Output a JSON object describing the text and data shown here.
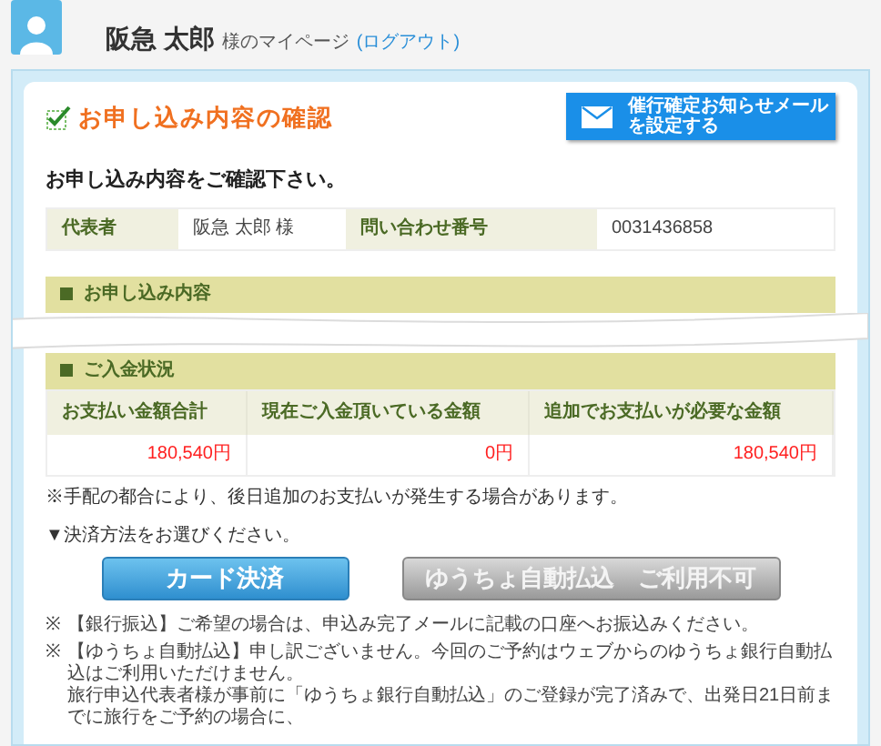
{
  "header": {
    "name": "阪急 太郎",
    "suffix": "様のマイページ",
    "logout": "(ログアウト)"
  },
  "title": "お申し込み内容の確認",
  "mail_button": {
    "lines": [
      "催行確定お知らせメール",
      "を設定する"
    ]
  },
  "prompt": "お申し込み内容をご確認下さい。",
  "info_table": [
    {
      "label": "代表者",
      "value": "阪急 太郎 様"
    },
    {
      "label": "問い合わせ番号",
      "value": "0031436858"
    }
  ],
  "application_section": {
    "heading": "お申し込み内容"
  },
  "payment_section": {
    "heading": "ご入金状況",
    "columns": [
      "お支払い金額合計",
      "現在ご入金頂いている金額",
      "追加でお支払いが必要な金額"
    ],
    "values": [
      "180,540円",
      "0円",
      "180,540円"
    ]
  },
  "payment_note": "※手配の都合により、後日追加のお支払いが発生する場合があります。",
  "select_prompt": "▼決済方法をお選びください。",
  "buttons": [
    {
      "label": "カード決済",
      "disabled": false
    },
    {
      "label": "ゆうちょ自動払込　ご利用不可",
      "disabled": true
    }
  ],
  "notes": [
    {
      "mark": "※",
      "lines": [
        "【銀行振込】ご希望の場合は、申込み完了メールに記載の口座へお振込みください。"
      ]
    },
    {
      "mark": "※",
      "lines": [
        "【ゆうちょ自動払込】申し訳ございません。今回のご予約はウェブからのゆうちょ銀行自動払込はご利用いただけません。",
        "旅行申込代表者様が事前に「ゆうちょ銀行自動払込」のご登録が完了済みで、出発日21日前までに旅行をご予約の場合に、"
      ]
    }
  ]
}
